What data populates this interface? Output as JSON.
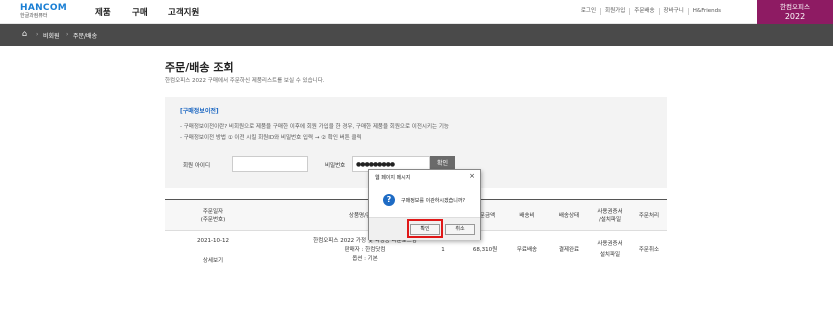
{
  "header": {
    "logo_mark": "HANCOM",
    "logo_sub": "한글과컴퓨터",
    "menu": [
      "제품",
      "구매",
      "고객지원"
    ],
    "links": [
      "로그인",
      "회원가입",
      "주문배송",
      "장바구니",
      "H&Friends"
    ],
    "promo_line1": "한컴오피스",
    "promo_line2": "2022"
  },
  "breadcrumb": {
    "home_icon": "home-icon",
    "items": [
      "비회원",
      "주문/배송"
    ]
  },
  "page": {
    "title": "주문/배송 조회",
    "subtitle": "한컴오피스 2022 구매에서 주문하신 제품리스트를 보실 수 있습니다."
  },
  "guest_panel": {
    "title": "[구매정보이전]",
    "line1": "- 구매정보이전이란?   비회원으로 제품을 구매한 이후에 회원 가입을 한 경우, 구매한 제품을 회원으로 이전시키는 기능",
    "line2": "- 구매정보이전 방법    ① 이전 시킬 회원ID와 비밀번호 입력  →  ② 확인 버튼 클릭",
    "id_label": "회원 아이디",
    "id_value": "",
    "pw_label": "비밀번호",
    "pw_value": "●●●●●●●●●",
    "confirm_label": "확인"
  },
  "table": {
    "headers": {
      "date": [
        "주문일자",
        "(주문번호)"
      ],
      "product": "상품명/판매자",
      "qty": "수량",
      "amount": "주문금액",
      "shipping": "배송비",
      "status": "배송상태",
      "license": [
        "사용권증서",
        "/설치파일"
      ],
      "process": "주문처리"
    },
    "rows": [
      {
        "date": "2021-10-12",
        "detail_link": "상세보기",
        "product_name": "한컴오피스 2022 가정 및 학생용 다운로드형",
        "seller": "판매자 : 한컴닷컴",
        "option": "옵션 : 기본",
        "qty": "1",
        "amount": "68,310원",
        "shipping": "무료배송",
        "status": "결제완료",
        "license": [
          "사용권증서",
          "설치파일"
        ],
        "process": "주문취소"
      }
    ]
  },
  "dialog": {
    "title": "웹 페이지 메시지",
    "close": "×",
    "message": "구매정보를 이관하시겠습니까?",
    "ok_label": "확인",
    "cancel_label": "취소",
    "highlight_color": "#e01818"
  }
}
